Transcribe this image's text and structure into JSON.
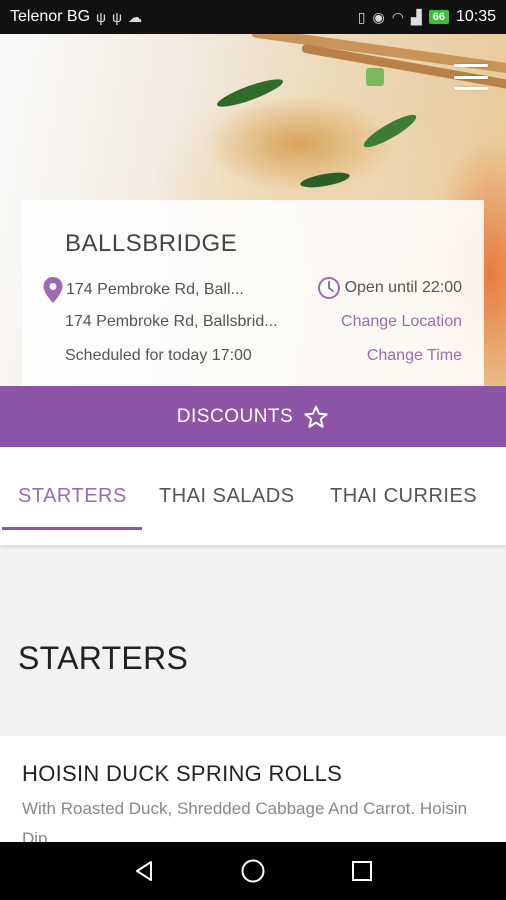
{
  "status_bar": {
    "carrier": "Telenor BG",
    "battery": "66",
    "time": "10:35"
  },
  "location": {
    "name": "BALLSBRIDGE",
    "address_short": "174 Pembroke Rd, Ball...",
    "address_long": "174 Pembroke Rd, Ballsbrid...",
    "hours": "Open until 22:00",
    "change_location": "Change Location",
    "schedule": "Scheduled for today 17:00",
    "change_time": "Change Time"
  },
  "discounts": {
    "label": "DISCOUNTS"
  },
  "tabs": [
    {
      "label": "STARTERS",
      "active": true
    },
    {
      "label": "THAI SALADS",
      "active": false
    },
    {
      "label": "THAI CURRIES",
      "active": false
    }
  ],
  "section": {
    "title": "STARTERS"
  },
  "items": [
    {
      "name": "HOISIN DUCK SPRING ROLLS",
      "description": "With Roasted Duck, Shredded Cabbage And Carrot. Hoisin Dip"
    }
  ],
  "colors": {
    "accent": "#8d55a5",
    "accent_text": "#9b6bb3"
  }
}
